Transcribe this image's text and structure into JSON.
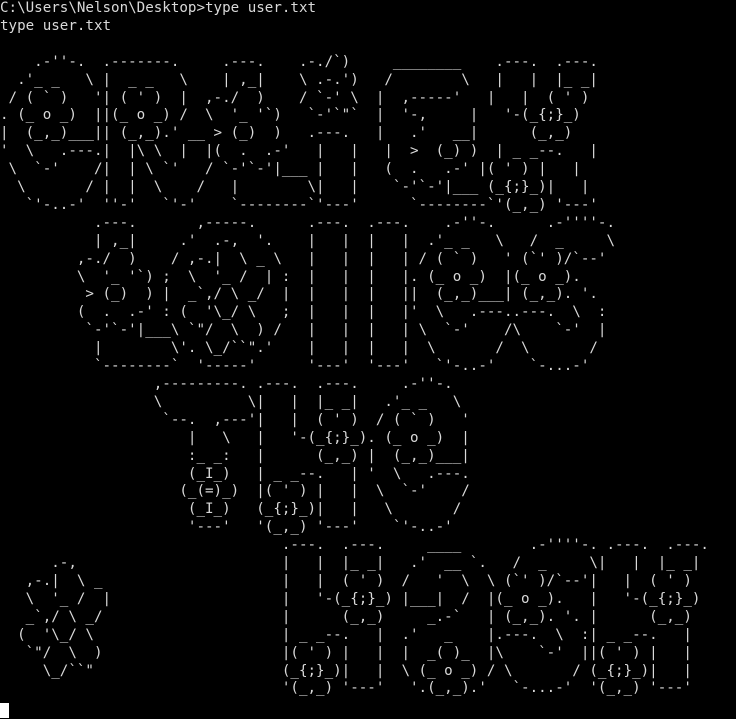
{
  "terminal": {
    "prompt_line": "C:\\Users\\Nelson\\Desktop>type user.txt",
    "echo_line": "type user.txt",
    "ascii_art": "\n    .-''-.  .-------.     .---.    .-./`)     ________    .---.  .---.\n  .'_ _   \\ |  _ _   \\    | ,_|    \\ .-.')   /        \\   |   |  |_ _|\n / ( ` )   '| ( ' )  |  ,-./  )    / `-' \\  |  ,-----'   |   |  ( ' )\n. (_ o _)  ||(_ o _) /  \\  '_ '`)   `-'`\"`  |  '-,     |   '-(_{;}_)\n|  (_,_)___|| (_,_).' __ > (_)  )   .---.   |   .'   __|      (_,_)\n'  \\   .---.|  |\\ \\  |  |(  .  .-'   |   |   |  >  (_) )  | _ _--.   |\n \\  `-'    /|  | \\ `'   / `-'`-'|___ |   |   (  .   .-' |( ' ) |   |\n  \\       / |  |  \\    /   |        \\|   |    `-'`-'|___ (_{;}_)|   |\n   `'-..-'  ''-'   `'-'    `--------`'---'      `--------`'(_,_) '---'\n           .---.       ,-----.      .---.  .---.    .-''-.      .-''''-.\n           | ,_|     .'  .-,  '.    |   |  |   |  .'_ _   \\   /  _     \\\n         ,-./  )    / ,-.|  \\ _ \\   |   |  |   | / ( ` )   ' (`' )/`--'\n         \\  '_ '`) ;  \\  '_ /  | :  |   |  |   |. (_ o _)  |(_ o _).\n          > (_)  ) |  _`,/ \\ _/  |  |   |  |   ||  (_,_)___| (_,_). '.\n         (  .  .-' : (  '\\_/ \\   ;  |   |  |   |'  \\   .---..---.  \\  :\n          `-'`-'|___\\ `\"/  \\  ) /   |   |  |   | \\  `-'    /\\    `-'  |\n           |        \\'. \\_/``\".'    |   |  |   |  \\       /  \\       /\n           `--------`  '-----'      '---'  '---'   `'-..-'    `-...-'\n                  ,---------. .---.  .---.     .-''-.\n                  \\          \\|   |  |_ _|   .'_ _   \\\n                   `--.  ,---'|   |  ( ' )  / ( ` )   '\n                      |   \\   |   '-(_{;}_). (_ o _)  |\n                      :_ _:   |      (_,_) |  (_,_)___|\n                      (_I_)   | _ _--.   | '  \\   .---.\n                     (_(=)_)  |( ' ) |   |  \\  `-'    /\n                      (_I_)   (_{;}_)|   |   \\       /\n                      '---'   '(_,_) '---'    `'-..-'\n                                 .---.  .---.     ____        .-''''-. .---.  .---.\n      .-,                        |   |  |_ _|   .'  __ `.   /  _     \\|   |  |_ _|\n   ,-.|  \\ _                     |   |  ( ' )  /   '  \\  \\ (`' )/`--'|   |  ( ' )\n   \\  '_ /  |                    |   '-(_{;}_) |___|  /  |(_ o _).   |   '-(_{;}_)\n   _`,/ \\ _/                     |      (_,_)     _.-`   | (_,_). '. |      (_,_)\n  (  '\\_/ \\                      | _ _--.   |  .'   _    |.---.  \\  :| _ _--.   |\n   `\"/  \\  )                     |( ' ) |   |  |  _( )_  |\\    `-'  ||( ' ) |   |\n     \\_/``\"                      (_{;}_)|   |  \\ (_ o _) / \\       / (_{;}_)|   |\n                                 '(_,_) '---'   '.(_,_).'   `-...-'  '(_,_) '---'"
  },
  "colors": {
    "background": "#000000",
    "foreground": "#d9d9d9",
    "cursor": "#ffffff"
  }
}
